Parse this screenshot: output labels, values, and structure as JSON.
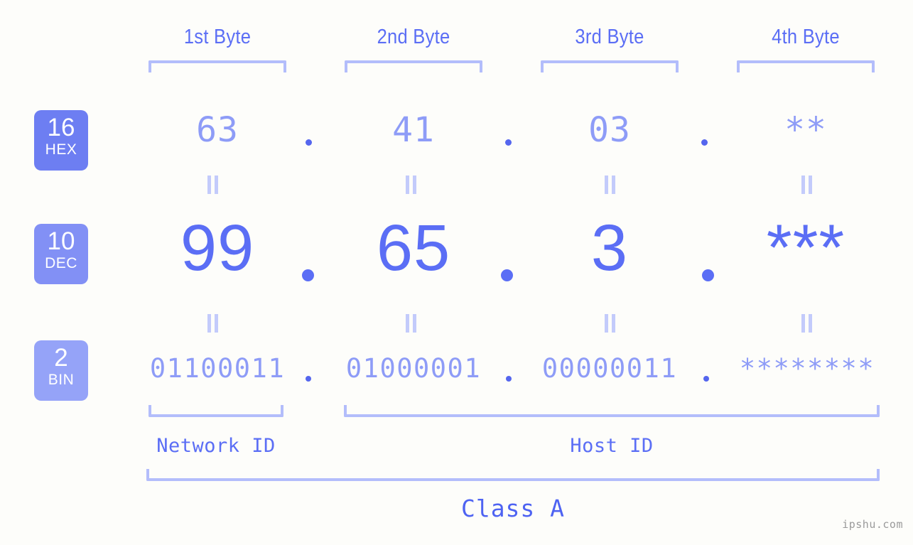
{
  "background_color": "#fdfdfa",
  "accent_color": "#5b6ef5",
  "accent_light_color": "#8e9cf7",
  "bracket_color": "#b3bdfb",
  "header": {
    "byte_labels": [
      {
        "label": "1st Byte"
      },
      {
        "label": "2nd Byte"
      },
      {
        "label": "3rd Byte"
      },
      {
        "label": "4th Byte"
      }
    ]
  },
  "radix_badges": [
    {
      "number": "16",
      "name": "HEX",
      "color": "#6d7ef2"
    },
    {
      "number": "10",
      "name": "DEC",
      "color": "#8290f5"
    },
    {
      "number": "2",
      "name": "BIN",
      "color": "#95a3f8"
    }
  ],
  "rows": {
    "hex": {
      "radix": "16",
      "radix_name": "HEX",
      "values": [
        "63",
        "41",
        "03",
        "**"
      ],
      "separator": "."
    },
    "dec": {
      "radix": "10",
      "radix_name": "DEC",
      "values": [
        "99",
        "65",
        "3",
        "***"
      ],
      "separator": "."
    },
    "bin": {
      "radix": "2",
      "radix_name": "BIN",
      "values": [
        "01100011",
        "01000001",
        "00000011",
        "********"
      ],
      "separator": "."
    }
  },
  "equality_marks": {
    "symbol": "||",
    "count_per_row": 4
  },
  "regions": {
    "network_id": {
      "label": "Network ID"
    },
    "host_id": {
      "label": "Host ID"
    },
    "class": {
      "label": "Class A"
    }
  },
  "watermark": {
    "text": "ipshu.com"
  },
  "chart_data": {
    "type": "table",
    "title": "IP address byte decomposition",
    "columns": [
      "1st Byte",
      "2nd Byte",
      "3rd Byte",
      "4th Byte"
    ],
    "rows": [
      {
        "radix": "16 HEX",
        "cells": [
          "63",
          "41",
          "03",
          "**"
        ]
      },
      {
        "radix": "10 DEC",
        "cells": [
          "99",
          "65",
          "3",
          "***"
        ]
      },
      {
        "radix": "2 BIN",
        "cells": [
          "01100011",
          "01000001",
          "00000011",
          "********"
        ]
      }
    ],
    "annotations": [
      "Network ID",
      "Host ID",
      "Class A"
    ]
  }
}
